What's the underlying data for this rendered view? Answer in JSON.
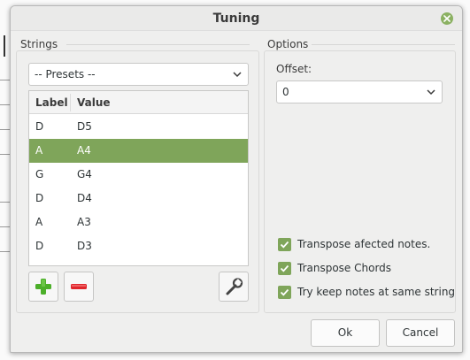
{
  "dialog": {
    "title": "Tuning"
  },
  "strings": {
    "group_title": "Strings",
    "presets": {
      "selected": "-- Presets --"
    },
    "columns": [
      "Label",
      "Value"
    ],
    "rows": [
      {
        "label": "D",
        "value": "D5",
        "selected": false
      },
      {
        "label": "A",
        "value": "A4",
        "selected": true
      },
      {
        "label": "G",
        "value": "G4",
        "selected": false
      },
      {
        "label": "D",
        "value": "D4",
        "selected": false
      },
      {
        "label": "A",
        "value": "A3",
        "selected": false
      },
      {
        "label": "D",
        "value": "D3",
        "selected": false
      }
    ],
    "tools": {
      "add_icon": "plus-icon",
      "remove_icon": "minus-icon",
      "edit_icon": "wrench-icon"
    }
  },
  "options": {
    "group_title": "Options",
    "offset_label": "Offset:",
    "offset_value": "0",
    "checks": [
      {
        "label": "Transpose afected notes.",
        "checked": true
      },
      {
        "label": "Transpose Chords",
        "checked": true
      },
      {
        "label": "Try keep notes at same string",
        "checked": true
      }
    ]
  },
  "buttons": {
    "ok": "Ok",
    "cancel": "Cancel"
  },
  "colors": {
    "accent": "#7fa55a",
    "close": "#8bb162",
    "add": "#4caf2a",
    "remove": "#e0262c"
  }
}
